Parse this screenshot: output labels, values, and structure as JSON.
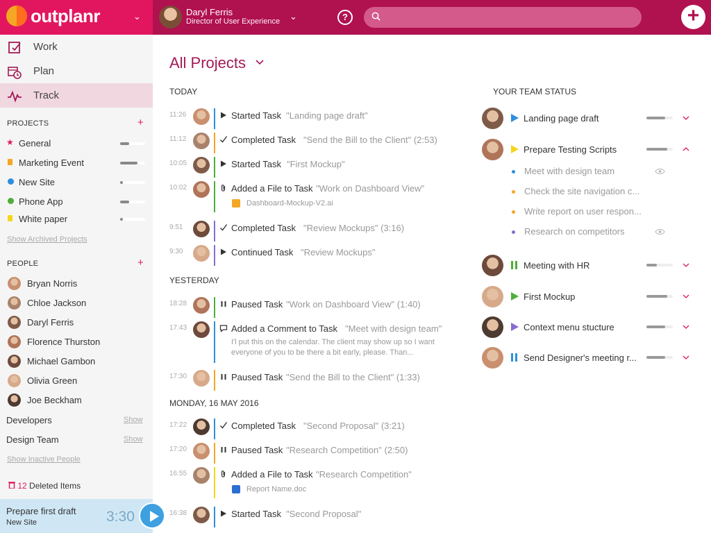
{
  "brand": {
    "name": "outplanr"
  },
  "user": {
    "name": "Daryl Ferris",
    "role": "Director of User Experience"
  },
  "search": {
    "placeholder": ""
  },
  "header": {
    "help_label": "?",
    "add_label": "+"
  },
  "nav": [
    {
      "label": "Work"
    },
    {
      "label": "Plan"
    },
    {
      "label": "Track"
    }
  ],
  "projects": {
    "heading": "PROJECTS",
    "add_label": "+",
    "items": [
      {
        "name": "General",
        "color": "#e2165f",
        "progress": 0.35
      },
      {
        "name": "Marketing Event",
        "color": "#f5a623",
        "progress": 0.7
      },
      {
        "name": "New Site",
        "color": "#2d8fdc",
        "progress": 0.1
      },
      {
        "name": "Phone App",
        "color": "#4caf3a",
        "progress": 0.35
      },
      {
        "name": "White paper",
        "color": "#f5d51e",
        "progress": 0.1
      }
    ],
    "archived_link": "Show Archived Projects"
  },
  "people": {
    "heading": "PEOPLE",
    "add_label": "+",
    "items": [
      "Bryan Norris",
      "Chloe Jackson",
      "Daryl Ferris",
      "Florence Thurston",
      "Michael Gambon",
      "Olivia Green",
      "Joe Beckham"
    ],
    "groups": [
      {
        "name": "Developers",
        "show": "Show"
      },
      {
        "name": "Design Team",
        "show": "Show"
      }
    ],
    "inactive_link": "Show Inactive People"
  },
  "deleted": {
    "count": "12",
    "label": "Deleted Items"
  },
  "timer": {
    "task": "Prepare first draft",
    "project": "New Site",
    "time": "3:30"
  },
  "main": {
    "title": "All Projects"
  },
  "activity": [
    {
      "day": "TODAY",
      "items": [
        {
          "time": "11:26",
          "verb": "Started Task",
          "obj": "\"Landing page draft\"",
          "color": "#2d8fdc",
          "icon": "play"
        },
        {
          "time": "11:12",
          "verb": "Completed Task",
          "obj": "\"Send the Bill to the Client\" (2:53)",
          "color": "#f5a623",
          "icon": "check"
        },
        {
          "time": "10:05",
          "verb": "Started Task",
          "obj": "\"First Mockup\"",
          "color": "#4caf3a",
          "icon": "play"
        },
        {
          "time": "10:02",
          "verb": "Added a File to Task",
          "obj": "\"Work on Dashboard View\"",
          "color": "#4caf3a",
          "icon": "clip",
          "attachment": "Dashboard-Mockup-V2.ai"
        },
        {
          "time": "9:51",
          "verb": "Completed Task",
          "obj": "\"Review Mockups\" (3:16)",
          "color": "#8a6bd4",
          "icon": "check"
        },
        {
          "time": "9:30",
          "verb": "Continued Task",
          "obj": "\"Review Mockups\"",
          "color": "#8a6bd4",
          "icon": "play"
        }
      ]
    },
    {
      "day": "YESTERDAY",
      "items": [
        {
          "time": "18:28",
          "verb": "Paused Task",
          "obj": "\"Work on Dashboard View\" (1:40)",
          "color": "#4caf3a",
          "icon": "pause"
        },
        {
          "time": "17:43",
          "verb": "Added a Comment to Task",
          "obj": "\"Meet with design team\"",
          "color": "#2d8fdc",
          "icon": "comment",
          "comment": "I'l put this on the calendar. The client may show up so I want everyone of you to be there a bit early, please. Than..."
        },
        {
          "time": "17:30",
          "verb": "Paused Task",
          "obj": "\"Send the Bill to the Client\" (1:33)",
          "color": "#f5a623",
          "icon": "pause"
        }
      ]
    },
    {
      "day": "MONDAY, 16 MAY 2016",
      "items": [
        {
          "time": "17:22",
          "verb": "Completed Task",
          "obj": "\"Second Proposal\" (3:21)",
          "color": "#2d8fdc",
          "icon": "check"
        },
        {
          "time": "17:20",
          "verb": "Paused Task",
          "obj": "\"Research Competition\" (2:50)",
          "color": "#f5a623",
          "icon": "pause"
        },
        {
          "time": "16:55",
          "verb": "Added a File to Task",
          "obj": "\"Research Competition\"",
          "color": "#f5d51e",
          "icon": "clip",
          "attachment": "Report Name.doc"
        },
        {
          "time": "16:38",
          "verb": "Started Task",
          "obj": "\"Second Proposal\"",
          "color": "#2d8fdc",
          "icon": "play"
        }
      ]
    }
  ],
  "team": {
    "heading": "YOUR TEAM STATUS",
    "members": [
      {
        "task": "Landing page draft",
        "status": "play",
        "color": "#2d8fdc",
        "progress": 0.7,
        "expanded": false
      },
      {
        "task": "Prepare Testing Scripts",
        "status": "play",
        "color": "#f5d51e",
        "progress": 0.8,
        "expanded": true,
        "subtasks": [
          {
            "label": "Meet with design team",
            "color": "#2d8fdc",
            "watch": true
          },
          {
            "label": "Check the site navigation c...",
            "color": "#f5a623",
            "watch": false
          },
          {
            "label": "Write report on user respon...",
            "color": "#f5a623",
            "watch": false
          },
          {
            "label": "Research on competitors",
            "color": "#8a6bd4",
            "watch": true
          }
        ]
      },
      {
        "task": "Meeting with HR",
        "status": "pause",
        "color": "#4caf3a",
        "progress": 0.4,
        "expanded": false
      },
      {
        "task": "First Mockup",
        "status": "play",
        "color": "#4caf3a",
        "progress": 0.8,
        "expanded": false
      },
      {
        "task": "Context menu stucture",
        "status": "play",
        "color": "#8a6bd4",
        "progress": 0.7,
        "expanded": false
      },
      {
        "task": "Send Designer's meeting r...",
        "status": "pause",
        "color": "#2d8fdc",
        "progress": 0.7,
        "expanded": false
      }
    ]
  }
}
